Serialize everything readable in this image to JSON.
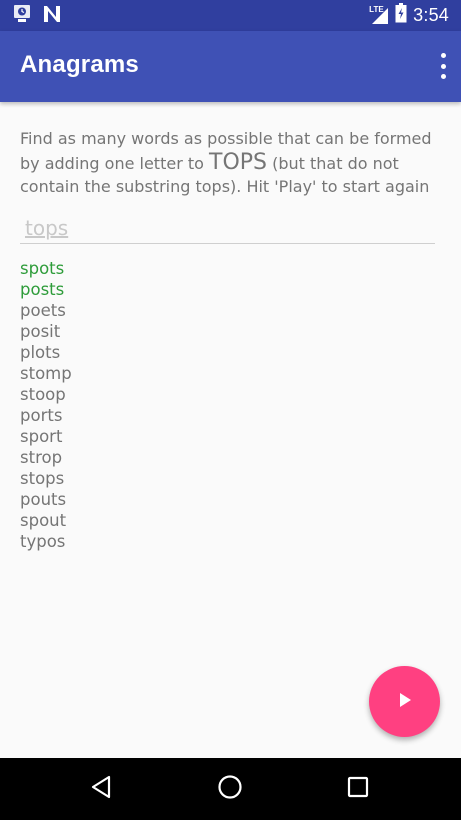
{
  "status_bar": {
    "time": "3:54",
    "network_label": "LTE",
    "icons": [
      "alarm-icon",
      "n-icon",
      "signal-icon",
      "battery-icon"
    ]
  },
  "app_bar": {
    "title": "Anagrams",
    "menu_icon": "overflow-menu-icon"
  },
  "instructions": {
    "before": "Find as many words as possible that can be formed by adding one letter to ",
    "starting_word": "TOPS",
    "after": " (but that do not contain the substring tops). Hit 'Play' to start again"
  },
  "input": {
    "value": "",
    "placeholder": "tops"
  },
  "words": [
    {
      "text": "spots",
      "found": true
    },
    {
      "text": "posts",
      "found": true
    },
    {
      "text": "poets",
      "found": false
    },
    {
      "text": "posit",
      "found": false
    },
    {
      "text": "plots",
      "found": false
    },
    {
      "text": "stomp",
      "found": false
    },
    {
      "text": "stoop",
      "found": false
    },
    {
      "text": "ports",
      "found": false
    },
    {
      "text": "sport",
      "found": false
    },
    {
      "text": "strop",
      "found": false
    },
    {
      "text": "stops",
      "found": false
    },
    {
      "text": "pouts",
      "found": false
    },
    {
      "text": "spout",
      "found": false
    },
    {
      "text": "typos",
      "found": false
    }
  ],
  "fab": {
    "icon": "play-icon"
  },
  "nav_bar": {
    "buttons": [
      "back-icon",
      "home-icon",
      "recents-icon"
    ]
  },
  "colors": {
    "status_bar": "#303f9f",
    "app_bar": "#3f51b5",
    "fab": "#ff4081",
    "found_word": "#2e9c3a",
    "text": "#757575",
    "background": "#fafafa"
  }
}
